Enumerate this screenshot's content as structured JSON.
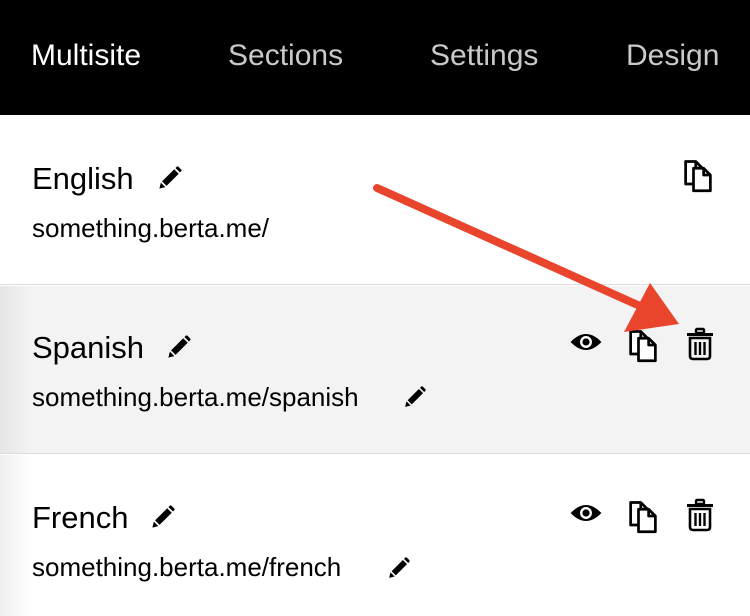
{
  "nav": {
    "tabs": [
      {
        "label": "Multisite",
        "active": true
      },
      {
        "label": "Sections",
        "active": false
      },
      {
        "label": "Settings",
        "active": false
      },
      {
        "label": "Design",
        "active": false
      }
    ]
  },
  "sites": [
    {
      "name": "English",
      "url": "something.berta.me/",
      "actions": [
        "copy-icon"
      ]
    },
    {
      "name": "Spanish",
      "url": "something.berta.me/spanish",
      "actions": [
        "eye-icon",
        "copy-icon",
        "trash-icon"
      ]
    },
    {
      "name": "French",
      "url": "something.berta.me/french",
      "actions": [
        "eye-icon",
        "copy-icon",
        "trash-icon"
      ]
    }
  ],
  "annotation": {
    "arrow_color": "#e8452c",
    "arrow_points_to": "trash-icon"
  },
  "colors": {
    "nav_background": "#000000",
    "active_tab": "#ffffff",
    "inactive_tab": "#c9c9c9",
    "highlight_row": "#f3f3f3"
  }
}
